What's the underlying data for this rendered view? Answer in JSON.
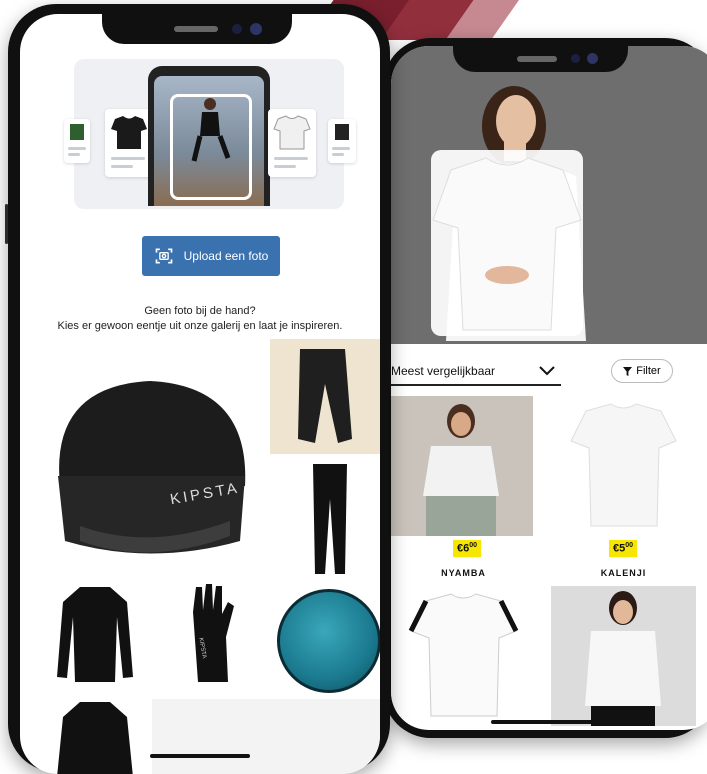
{
  "left_phone": {
    "upload_button": {
      "label": "Upload een foto",
      "icon": "camera-scan-icon"
    },
    "helper_text": {
      "line1": "Geen foto bij de hand?",
      "line2": "Kies er gewoon eentje uit onze galerij en laat je inspireren."
    },
    "gallery": [
      {
        "name": "beanie",
        "logo_text": "KIPSTA"
      },
      {
        "name": "rain-pants"
      },
      {
        "name": "leggings"
      },
      {
        "name": "long-sleeve-base-layer"
      },
      {
        "name": "glove",
        "logo_text": "KIPSTA"
      },
      {
        "name": "round-towel"
      },
      {
        "name": "base-layer-top"
      }
    ]
  },
  "right_phone": {
    "sort": {
      "selected": "Meest vergelijkbaar",
      "icon": "chevron-down-icon"
    },
    "filter": {
      "label": "Filter",
      "icon": "filter-icon"
    },
    "products": [
      {
        "price_main": "€6",
        "price_cents": "00",
        "brand": "NYAMBA"
      },
      {
        "price_main": "€5",
        "price_cents": "00",
        "brand": "KALENJI"
      },
      {
        "price_main": "",
        "price_cents": "",
        "brand": ""
      },
      {
        "price_main": "",
        "price_cents": "",
        "brand": ""
      }
    ]
  },
  "colors": {
    "upload_button_bg": "#3a72b0",
    "price_tag_bg": "#f7e600",
    "accent": "#7a1f2e"
  }
}
